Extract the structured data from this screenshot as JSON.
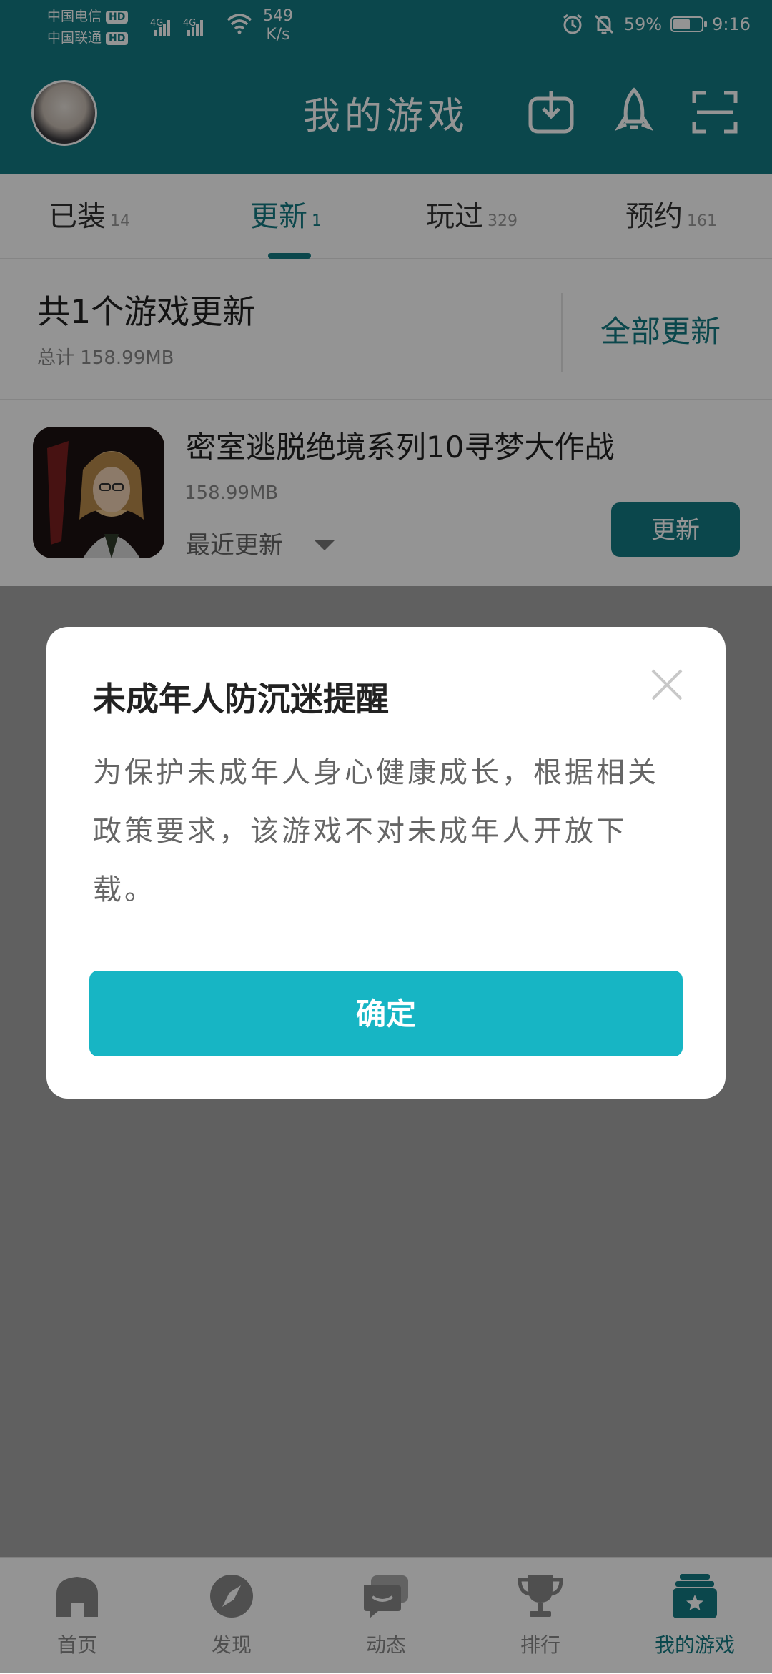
{
  "status_bar": {
    "carrier1": "中国电信",
    "carrier2": "中国联通",
    "hd": "HD",
    "net_type": "4G",
    "speed_value": "549",
    "speed_unit": "K/s",
    "battery": "59%",
    "battery_level": 0.59,
    "time": "9:16"
  },
  "header": {
    "title": "我的游戏"
  },
  "tabs": [
    {
      "label": "已装",
      "count": "14"
    },
    {
      "label": "更新",
      "count": "1"
    },
    {
      "label": "玩过",
      "count": "329"
    },
    {
      "label": "预约",
      "count": "161"
    }
  ],
  "summary": {
    "title": "共1个游戏更新",
    "total": "总计 158.99MB",
    "update_all": "全部更新"
  },
  "game": {
    "name": "密室逃脱绝境系列10寻梦大作战",
    "size": "158.99MB",
    "recent": "最近更新",
    "update_button": "更新"
  },
  "dialog": {
    "title": "未成年人防沉迷提醒",
    "body": "为保护未成年人身心健康成长，根据相关政策要求，该游戏不对未成年人开放下载。",
    "confirm": "确定"
  },
  "bottom_nav": [
    {
      "label": "首页",
      "icon": "home-icon"
    },
    {
      "label": "发现",
      "icon": "compass-icon"
    },
    {
      "label": "动态",
      "icon": "chat-icon"
    },
    {
      "label": "排行",
      "icon": "trophy-icon"
    },
    {
      "label": "我的游戏",
      "icon": "my-games-icon"
    }
  ],
  "colors": {
    "primary": "#137b83",
    "dialog_button": "#17b5c4"
  }
}
